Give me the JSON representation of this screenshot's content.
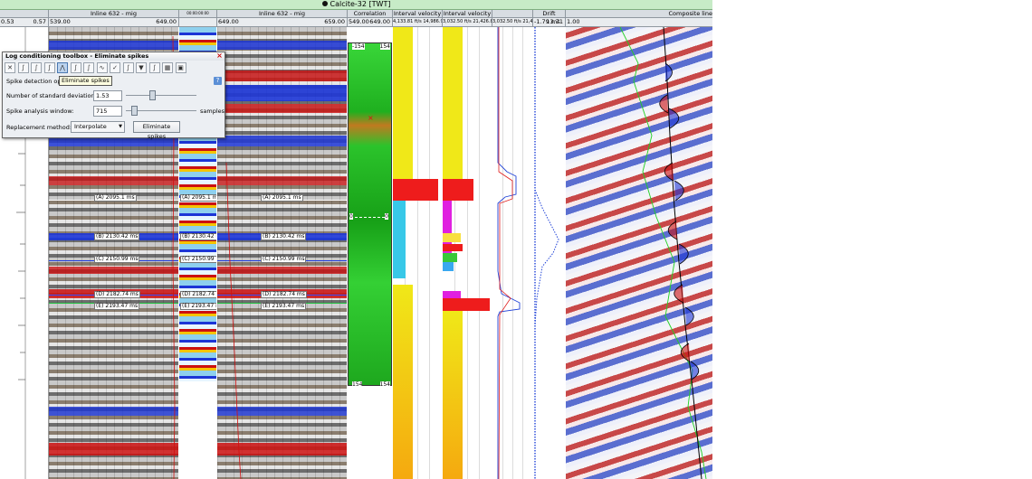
{
  "window": {
    "title": "Calcite-32 [TWT]"
  },
  "headers": {
    "track_small": "",
    "inline_a": "Inline 632 - mig",
    "narrow_panel": "00:00:00:00",
    "inline_b": "Inline 632 - mig",
    "correlation": "Correlation",
    "interval_velocity_1": "Interval velocity",
    "interval_velocity_2": "Interval velocity",
    "log_track": "",
    "drift": "Drift",
    "composite": "Composite line"
  },
  "ranges": {
    "left_min": "0.53",
    "left_max": "0.57",
    "inline_a_min": "539.00",
    "inline_a_max": "649.00",
    "inline_b_min": "649.00",
    "inline_b_max": "659.00",
    "corr_min": "549.00",
    "corr_max": "649.00",
    "iv1": "4,133.81 ft/s 14,986.94",
    "iv2": "3,032.50 ft/s 21,426.88",
    "log": "3,032.50 ft/s 21,426.88",
    "drift_min": "-1.79 ms",
    "drift_max": "13.71",
    "comp_min": "1.00"
  },
  "correlation": {
    "top_left": "-154",
    "top_right": "154",
    "mid_left": "0",
    "mid_right": "0",
    "bot_left": "154",
    "bot_right": "154"
  },
  "horizons": [
    {
      "label": "(A) 2095.1 ms",
      "color": "#ffffff"
    },
    {
      "label": "(B) 2130.42 ms",
      "color": "#1e3cdc"
    },
    {
      "label": "(C) 2150.99 ms",
      "color": "#1e3cdc"
    },
    {
      "label": "(D) 2182.74 ms",
      "color": "#3a50ff"
    },
    {
      "label": "(E) 2193.47 ms",
      "color": "#20c040"
    }
  ],
  "dialog": {
    "title": "Log conditioning toolbox - Eliminate spikes",
    "section": "Spike detection options",
    "tooltip": "Eliminate spikes",
    "std_label": "Number of standard deviation:",
    "std_value": "1.53",
    "std_level": 0.35,
    "window_label": "Spike analysis window:",
    "window_value": "715",
    "window_unit": "samples",
    "window_level": 0.08,
    "replacement_label": "Replacement method:",
    "replacement_value": "Interpolate",
    "run_button": "Eliminate spikes",
    "close": "×",
    "help": "?",
    "tools": [
      "x-icon",
      "curve-icon",
      "curve-icon",
      "curve-icon",
      "eliminate-spikes-icon",
      "curve-icon",
      "curve-icon",
      "wave-icon",
      "check-icon",
      "curve-icon",
      "filter-icon",
      "curve-icon",
      "table-icon",
      "save-icon"
    ]
  },
  "colors": {
    "seismic_red": "#cc1010",
    "seismic_blue": "#1c35d6",
    "corr_green": "#22c322",
    "iv_yellow": "#f0e818",
    "iv_orange": "#f5a90f",
    "log_red": "#e01c1c",
    "drift_blue": "#2244d8",
    "green_log": "#20d020"
  }
}
